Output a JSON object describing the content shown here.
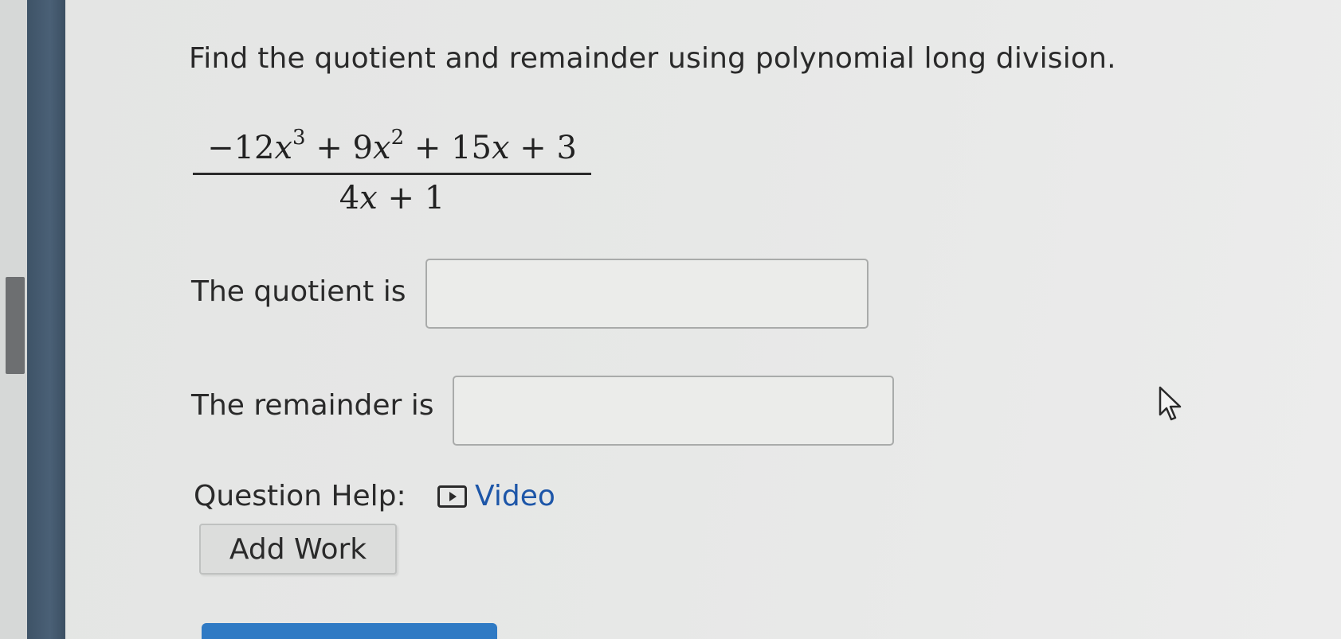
{
  "question": {
    "title": "Find the quotient and remainder using polynomial long division.",
    "numerator": {
      "t1_coef": "−12",
      "t1_var": "x",
      "t1_exp": "3",
      "op1": "+",
      "t2_coef": "9",
      "t2_var": "x",
      "t2_exp": "2",
      "op2": "+",
      "t3_coef": "15",
      "t3_var": "x",
      "op3": "+",
      "t4": "3"
    },
    "denominator": {
      "coef": "4",
      "var": "x",
      "op": "+",
      "const": "1"
    }
  },
  "answers": {
    "quotient_label": "The quotient is",
    "quotient_value": "",
    "remainder_label": "The remainder is",
    "remainder_value": ""
  },
  "help": {
    "label": "Question Help:",
    "video_icon": "play-icon",
    "video_label": "Video"
  },
  "buttons": {
    "add_work": "Add Work"
  },
  "colors": {
    "sidebar": "#44596d",
    "link": "#1d56a8",
    "submit": "#2f7ac4",
    "scrollbar_thumb": "#6d6f71"
  }
}
